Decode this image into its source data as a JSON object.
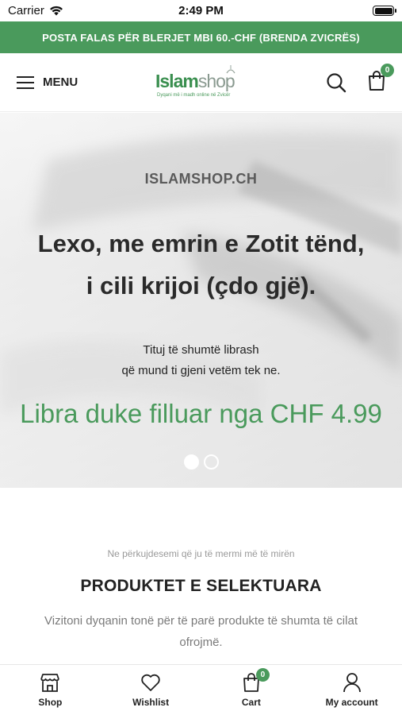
{
  "status_bar": {
    "carrier": "Carrier",
    "time": "2:49 PM"
  },
  "promo": {
    "text": "POSTA FALAS PËR BLERJET MBI 60.-CHF (BRENDA ZVICRËS)"
  },
  "header": {
    "menu_label": "MENU",
    "logo": {
      "brand_left": "Islam",
      "brand_right": "shop",
      "tagline": "Dyqani më i madh online në Zvicër"
    },
    "cart_count": "0"
  },
  "hero": {
    "kicker": "ISLAMSHOP.CH",
    "title_line1": "Lexo, me emrin e Zotit tënd,",
    "title_line2": "i cili krijoi (çdo gjë).",
    "sub_line1": "Tituj të shumtë librash",
    "sub_line2": "që mund ti gjeni vetëm tek ne.",
    "price_text": "Libra duke filluar nga CHF 4.99",
    "slides_total": 2,
    "active_slide": 1
  },
  "section": {
    "tagline": "Ne përkujdesemi që ju të mermi më të mirën",
    "title": "PRODUKTET E SELEKTUARA",
    "description": "Vizitoni dyqanin tonë për të parë produkte të shumta të cilat ofrojmë."
  },
  "tabbar": {
    "items": [
      {
        "label": "Shop",
        "icon": "storefront-icon"
      },
      {
        "label": "Wishlist",
        "icon": "heart-icon"
      },
      {
        "label": "Cart",
        "icon": "shopping-bag-icon",
        "badge": "0"
      },
      {
        "label": "My account",
        "icon": "user-icon"
      }
    ]
  },
  "colors": {
    "brand_green": "#4a9a5c",
    "text_dark": "#222222",
    "muted": "#7a7a7a"
  }
}
